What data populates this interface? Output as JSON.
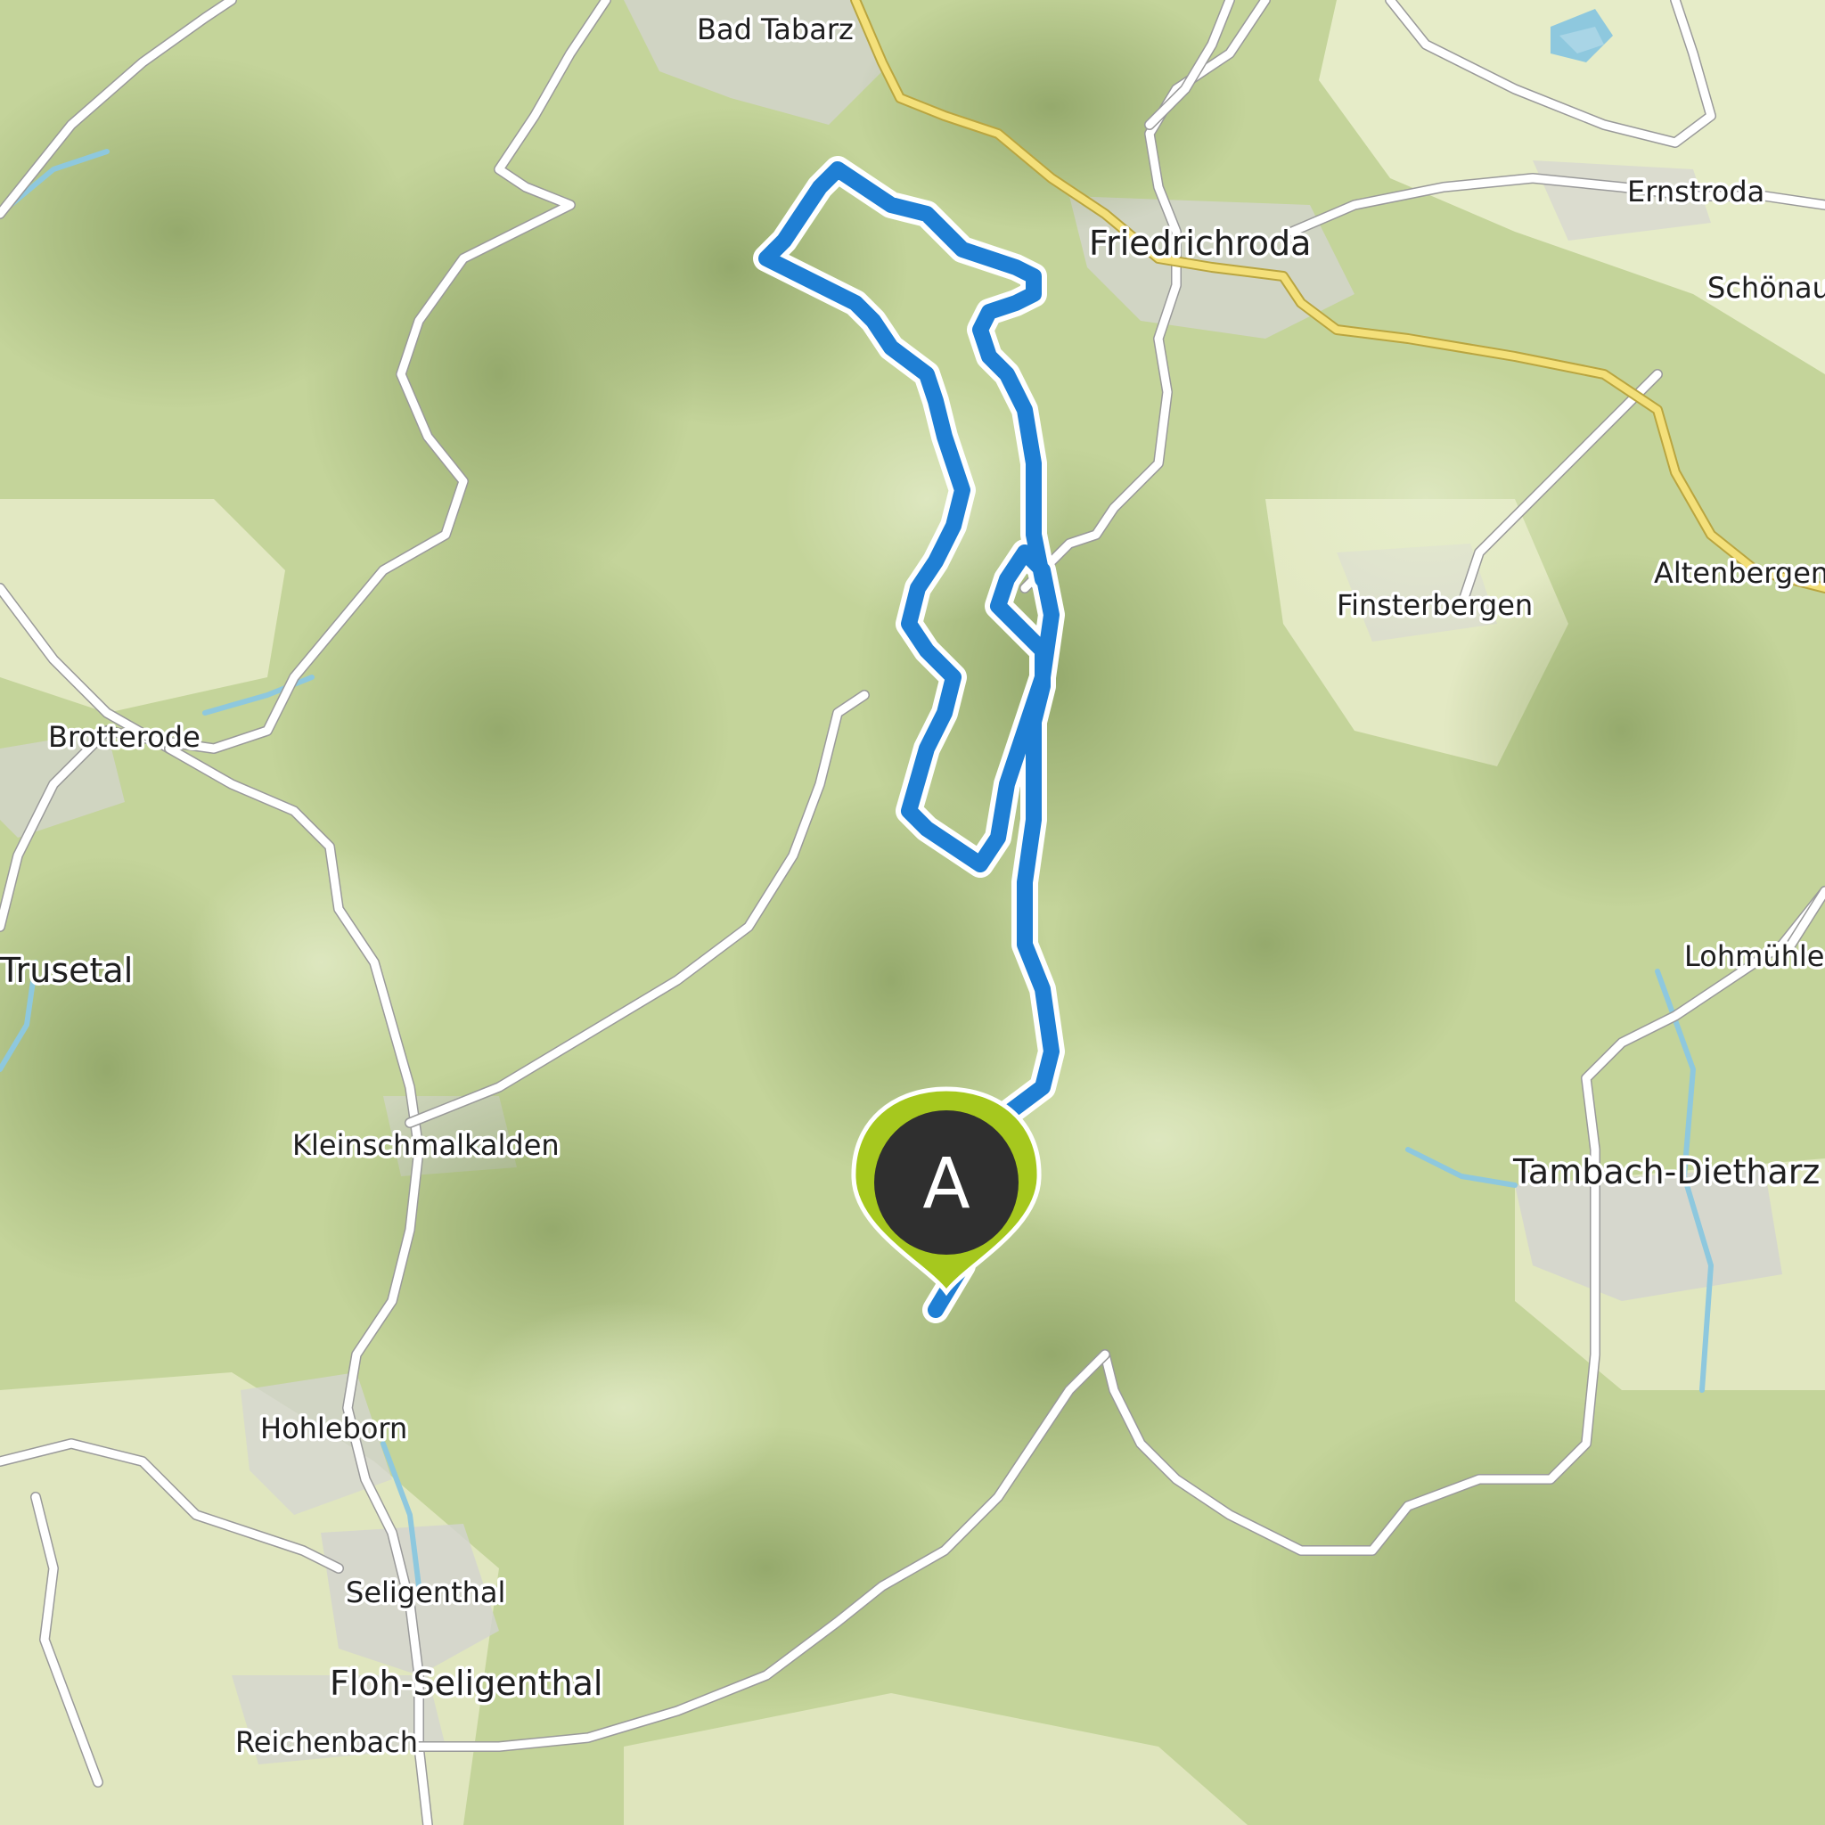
{
  "map": {
    "places": {
      "bad_tabarz": "Bad Tabarz",
      "friedrichroda": "Friedrichroda",
      "ernstroda": "Ernstroda",
      "schonau": "Schönau",
      "altenbergen": "Altenbergen",
      "finsterbergen": "Finsterbergen",
      "brotterode": "Brotterode",
      "trusetal": "Trusetal",
      "lohmuhle": "Lohmühle",
      "kleinschmalkalden": "Kleinschmalkalden",
      "tambach_dietharz": "Tambach-Dietharz",
      "hohleborn": "Hohleborn",
      "seligenthal": "Seligenthal",
      "floh_seligenthal": "Floh-Seligenthal",
      "reichenbach": "Reichenbach"
    },
    "start_marker": {
      "label": "A",
      "icon": "map-pin-icon",
      "color": "#a6c81e"
    },
    "route": {
      "color": "#1f7fd4"
    }
  }
}
